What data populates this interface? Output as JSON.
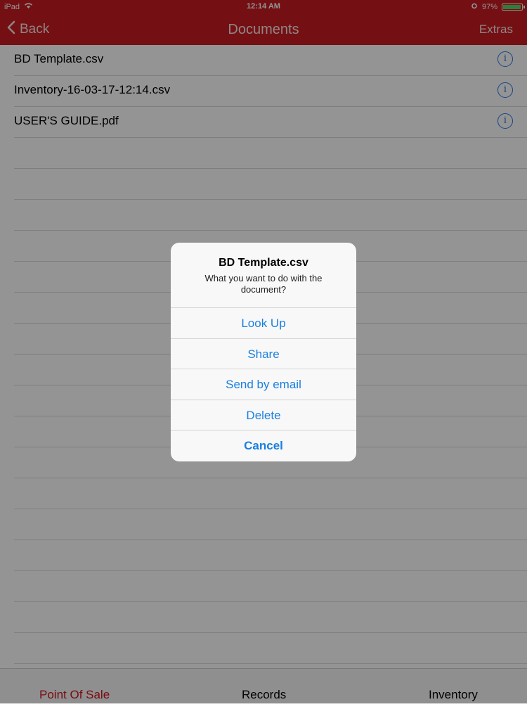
{
  "status_bar": {
    "device": "iPad",
    "time": "12:14 AM",
    "battery": "97%",
    "battery_level": 0.97
  },
  "nav": {
    "back_label": "Back",
    "title": "Documents",
    "extras_label": "Extras"
  },
  "documents": [
    {
      "name": "BD Template.csv"
    },
    {
      "name": "Inventory-16-03-17-12:14.csv"
    },
    {
      "name": "USER'S GUIDE.pdf"
    }
  ],
  "alert": {
    "title": "BD Template.csv",
    "message": "What you want to do with the document?",
    "buttons": [
      {
        "label": "Look Up"
      },
      {
        "label": "Share"
      },
      {
        "label": "Send by email"
      },
      {
        "label": "Delete"
      },
      {
        "label": "Cancel"
      }
    ]
  },
  "tabbar": {
    "tabs": [
      {
        "label": "Point Of Sale",
        "active": true
      },
      {
        "label": "Records",
        "active": false
      },
      {
        "label": "Inventory",
        "active": false
      }
    ]
  },
  "colors": {
    "brand_red": "#c81d22",
    "link_blue": "#1a7fe0"
  },
  "icons": [
    "wifi-icon",
    "alarm-icon",
    "battery-icon",
    "chevron-left-icon",
    "info-icon"
  ]
}
